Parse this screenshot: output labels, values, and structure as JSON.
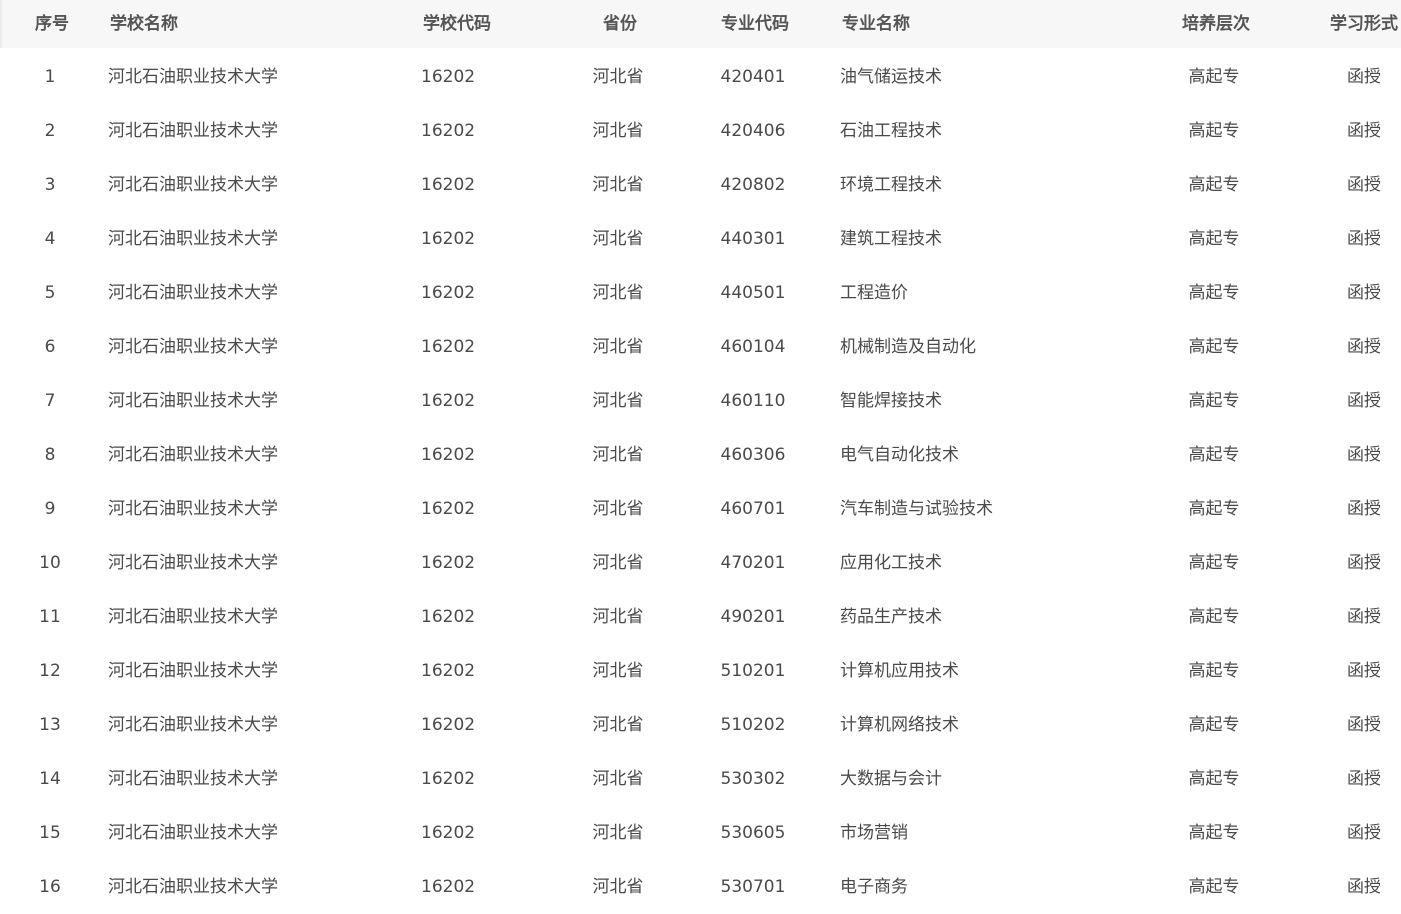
{
  "table": {
    "columns": [
      "序号",
      "学校名称",
      "学校代码",
      "省份",
      "专业代码",
      "专业名称",
      "培养层次",
      "学习形式"
    ],
    "rows": [
      {
        "index": "1",
        "school": "河北石油职业技术大学",
        "school_code": "16202",
        "province": "河北省",
        "major_code": "420401",
        "major": "油气储运技术",
        "level": "高起专",
        "mode": "函授"
      },
      {
        "index": "2",
        "school": "河北石油职业技术大学",
        "school_code": "16202",
        "province": "河北省",
        "major_code": "420406",
        "major": "石油工程技术",
        "level": "高起专",
        "mode": "函授"
      },
      {
        "index": "3",
        "school": "河北石油职业技术大学",
        "school_code": "16202",
        "province": "河北省",
        "major_code": "420802",
        "major": "环境工程技术",
        "level": "高起专",
        "mode": "函授"
      },
      {
        "index": "4",
        "school": "河北石油职业技术大学",
        "school_code": "16202",
        "province": "河北省",
        "major_code": "440301",
        "major": "建筑工程技术",
        "level": "高起专",
        "mode": "函授"
      },
      {
        "index": "5",
        "school": "河北石油职业技术大学",
        "school_code": "16202",
        "province": "河北省",
        "major_code": "440501",
        "major": "工程造价",
        "level": "高起专",
        "mode": "函授"
      },
      {
        "index": "6",
        "school": "河北石油职业技术大学",
        "school_code": "16202",
        "province": "河北省",
        "major_code": "460104",
        "major": "机械制造及自动化",
        "level": "高起专",
        "mode": "函授"
      },
      {
        "index": "7",
        "school": "河北石油职业技术大学",
        "school_code": "16202",
        "province": "河北省",
        "major_code": "460110",
        "major": "智能焊接技术",
        "level": "高起专",
        "mode": "函授"
      },
      {
        "index": "8",
        "school": "河北石油职业技术大学",
        "school_code": "16202",
        "province": "河北省",
        "major_code": "460306",
        "major": "电气自动化技术",
        "level": "高起专",
        "mode": "函授"
      },
      {
        "index": "9",
        "school": "河北石油职业技术大学",
        "school_code": "16202",
        "province": "河北省",
        "major_code": "460701",
        "major": "汽车制造与试验技术",
        "level": "高起专",
        "mode": "函授"
      },
      {
        "index": "10",
        "school": "河北石油职业技术大学",
        "school_code": "16202",
        "province": "河北省",
        "major_code": "470201",
        "major": "应用化工技术",
        "level": "高起专",
        "mode": "函授"
      },
      {
        "index": "11",
        "school": "河北石油职业技术大学",
        "school_code": "16202",
        "province": "河北省",
        "major_code": "490201",
        "major": "药品生产技术",
        "level": "高起专",
        "mode": "函授"
      },
      {
        "index": "12",
        "school": "河北石油职业技术大学",
        "school_code": "16202",
        "province": "河北省",
        "major_code": "510201",
        "major": "计算机应用技术",
        "level": "高起专",
        "mode": "函授"
      },
      {
        "index": "13",
        "school": "河北石油职业技术大学",
        "school_code": "16202",
        "province": "河北省",
        "major_code": "510202",
        "major": "计算机网络技术",
        "level": "高起专",
        "mode": "函授"
      },
      {
        "index": "14",
        "school": "河北石油职业技术大学",
        "school_code": "16202",
        "province": "河北省",
        "major_code": "530302",
        "major": "大数据与会计",
        "level": "高起专",
        "mode": "函授"
      },
      {
        "index": "15",
        "school": "河北石油职业技术大学",
        "school_code": "16202",
        "province": "河北省",
        "major_code": "530605",
        "major": "市场营销",
        "level": "高起专",
        "mode": "函授"
      },
      {
        "index": "16",
        "school": "河北石油职业技术大学",
        "school_code": "16202",
        "province": "河北省",
        "major_code": "530701",
        "major": "电子商务",
        "level": "高起专",
        "mode": "函授"
      }
    ]
  }
}
